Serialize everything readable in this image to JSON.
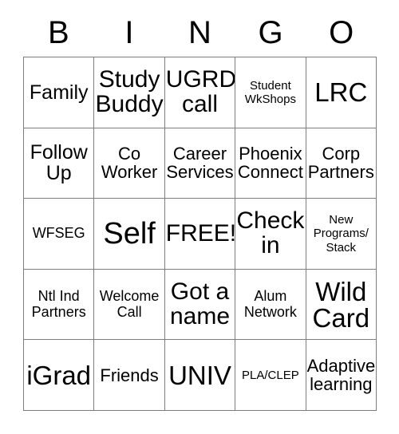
{
  "card": {
    "title_letters": [
      "B",
      "I",
      "N",
      "G",
      "O"
    ],
    "border_color": "#7d7d7d",
    "text_color": "#000000",
    "background_color": "#ffffff",
    "columns": 5,
    "rows": 5,
    "free_space_label": "FREE!",
    "cells": [
      {
        "text": "Family",
        "size": "lg"
      },
      {
        "text": "Study\nBuddy",
        "size": "xl"
      },
      {
        "text": "UGRD\ncall",
        "size": "xl"
      },
      {
        "text": "Student\nWkShops",
        "size": "xs"
      },
      {
        "text": "LRC",
        "size": "xxl"
      },
      {
        "text": "Follow\nUp",
        "size": "lg"
      },
      {
        "text": "Co\nWorker",
        "size": "md"
      },
      {
        "text": "Career\nServices",
        "size": "md"
      },
      {
        "text": "Phoenix\nConnect",
        "size": "md"
      },
      {
        "text": "Corp\nPartners",
        "size": "md"
      },
      {
        "text": "WFSEG",
        "size": "sm"
      },
      {
        "text": "Self",
        "size": "hg"
      },
      {
        "text": "FREE!",
        "size": "xl"
      },
      {
        "text": "Check\nin",
        "size": "xl"
      },
      {
        "text": "New\nPrograms/\nStack",
        "size": "xs"
      },
      {
        "text": "Ntl Ind\nPartners",
        "size": "sm"
      },
      {
        "text": "Welcome\nCall",
        "size": "sm"
      },
      {
        "text": "Got a\nname",
        "size": "xl"
      },
      {
        "text": "Alum\nNetwork",
        "size": "sm"
      },
      {
        "text": "Wild\nCard",
        "size": "xxl"
      },
      {
        "text": "iGrad",
        "size": "xxl"
      },
      {
        "text": "Friends",
        "size": "md"
      },
      {
        "text": "UNIV",
        "size": "xxl"
      },
      {
        "text": "PLA/CLEP",
        "size": "xs"
      },
      {
        "text": "Adaptive\nlearning",
        "size": "md"
      }
    ]
  }
}
